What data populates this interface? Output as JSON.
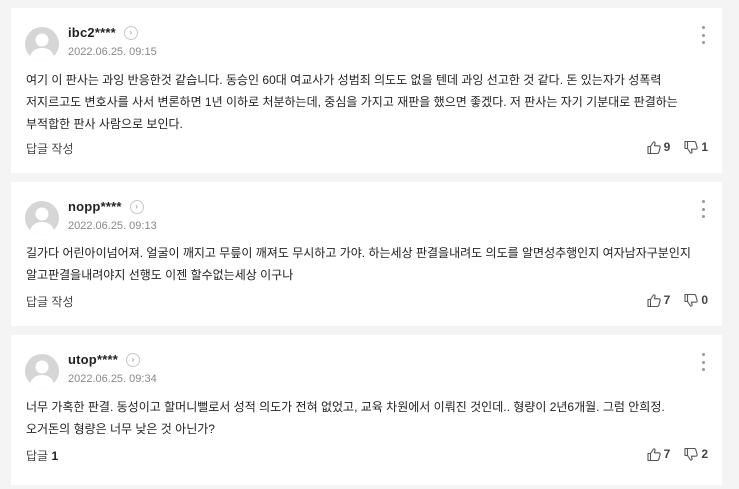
{
  "comments": [
    {
      "user": "ibc2****",
      "date": "2022.06.25. 09:15",
      "text": "여기 이 판사는 과잉 반응한것 같습니다. 동승인 60대 여교사가 성범죄 의도도 없을 텐데 과잉 선고한 것 같다. 돈 있는자가 성폭력 저지르고도 변호사를 사서 변론하면 1년 이하로 처분하는데, 중심을 가지고 재판을 했으면 좋겠다. 저 판사는 자기 기분대로 판결하는 부적합한 판사 사람으로 보인다.",
      "reply_label": "답글 작성",
      "reply_count": "",
      "likes": "9",
      "dislikes": "1"
    },
    {
      "user": "nopp****",
      "date": "2022.06.25. 09:13",
      "text": "길가다 어린아이넘어져. 얼굴이 깨지고 무릎이 깨져도 무시하고 가야. 하는세상 판결을내려도 의도를 알면성추행인지 여자남자구분인지 알고판결을내려야지 선행도 이젠 할수없는세상 이구나",
      "reply_label": "답글 작성",
      "reply_count": "",
      "likes": "7",
      "dislikes": "0"
    },
    {
      "user": "utop****",
      "date": "2022.06.25. 09:34",
      "text": "너무 가혹한 판결. 동성이고 할머니뻘로서 성적 의도가 전혀 없었고, 교육 차원에서 이뤄진 것인데.. 형량이 2년6개월. 그럼 안희정.오거돈의 형량은 너무 낮은 것 아닌가?",
      "reply_label": "답글",
      "reply_count": "1",
      "likes": "7",
      "dislikes": "2"
    }
  ],
  "icons": {
    "profile": "default-avatar-icon",
    "profile_link": "chevron-right-circle-icon",
    "menu": "more-vertical-icon",
    "like": "thumbs-up-icon",
    "dislike": "thumbs-down-icon"
  },
  "colors": {
    "background": "#f4f4f4",
    "card": "#ffffff",
    "avatar": "#d6d6d6",
    "muted": "#888888"
  }
}
